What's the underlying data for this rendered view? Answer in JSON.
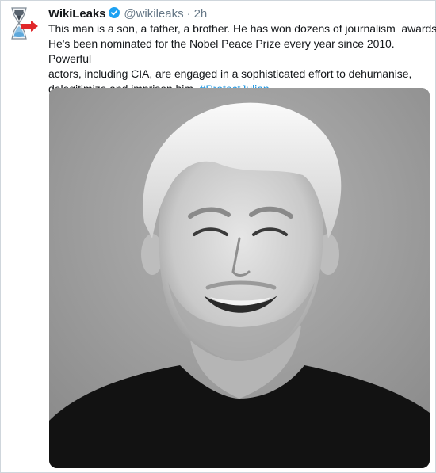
{
  "tweet": {
    "author": {
      "display_name": "WikiLeaks",
      "handle": "@wikileaks",
      "verified": true,
      "avatar_icon": "hourglass-logo-icon"
    },
    "separator": "·",
    "timestamp": "2h",
    "text_line1": "This man is a son, a father, a brother. He has won dozens of journalism  awards.",
    "text_line2": "He's been nominated for the Nobel Peace Prize every year since 2010. Powerful",
    "text_line3": "actors, including CIA, are engaged in a sophisticated effort to dehumanise,",
    "text_line4_prefix": "delegitimize and imprison him.",
    "hashtag": "#ProtectJulian",
    "media": {
      "type": "photo",
      "style": "black-and-white portrait"
    }
  },
  "colors": {
    "text": "#14171a",
    "muted": "#657786",
    "link": "#1b95e0",
    "verified": "#1da1f2",
    "border": "#cfd6dc",
    "avatar_arrow": "#e0272a"
  }
}
